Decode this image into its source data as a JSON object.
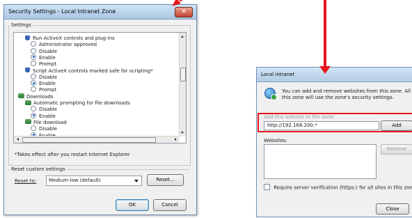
{
  "security_dialog": {
    "title": "Security Settings - Local Intranet Zone",
    "close_glyph": "✕",
    "settings_group": "Settings",
    "tree": [
      {
        "type": "header",
        "icon": "shield-icon",
        "label": "Run ActiveX controls and plug-ins"
      },
      {
        "type": "radio",
        "label": "Administrator approved",
        "selected": false
      },
      {
        "type": "radio",
        "label": "Disable",
        "selected": false
      },
      {
        "type": "radio",
        "label": "Enable",
        "selected": true
      },
      {
        "type": "radio",
        "label": "Prompt",
        "selected": false
      },
      {
        "type": "header",
        "icon": "shield-icon",
        "label": "Script ActiveX controls marked safe for scripting*"
      },
      {
        "type": "radio",
        "label": "Disable",
        "selected": false
      },
      {
        "type": "radio",
        "label": "Enable",
        "selected": true
      },
      {
        "type": "radio",
        "label": "Prompt",
        "selected": false
      },
      {
        "type": "category",
        "icon": "downloads-icon",
        "label": "Downloads"
      },
      {
        "type": "header",
        "icon": "downloads-icon",
        "label": "Automatic prompting for file downloads"
      },
      {
        "type": "radio",
        "label": "Disable",
        "selected": false
      },
      {
        "type": "radio",
        "label": "Enable",
        "selected": true
      },
      {
        "type": "header",
        "icon": "downloads-icon",
        "label": "File download"
      },
      {
        "type": "radio",
        "label": "Disable",
        "selected": false
      },
      {
        "type": "radio",
        "label": "Enable",
        "selected": true
      }
    ],
    "note": "*Takes effect after you restart Internet Explorer",
    "reset_group": "Reset custom settings",
    "reset_to_label": "Reset to:",
    "reset_level": "Medium-low (default)",
    "reset_button": "Reset...",
    "ok_button": "OK",
    "cancel_button": "Cancel"
  },
  "intranet_dialog": {
    "title": "Local intranet",
    "description_line1": "You can add and remove websites from this zone. All websit",
    "description_line2": "this zone will use the zone's security settings.",
    "add_field_label": "Add this website to the zone:",
    "add_field_value": "http://192.168.200.*",
    "add_button": "Add",
    "websites_label": "Websites:",
    "remove_button": "Remove",
    "https_checkbox": "Require server verification (https:) for all sites in this zone",
    "https_checked": false,
    "close_button": "Close"
  },
  "colors": {
    "highlight_red": "#e8141b",
    "title_blue": "#a9c6e4"
  }
}
